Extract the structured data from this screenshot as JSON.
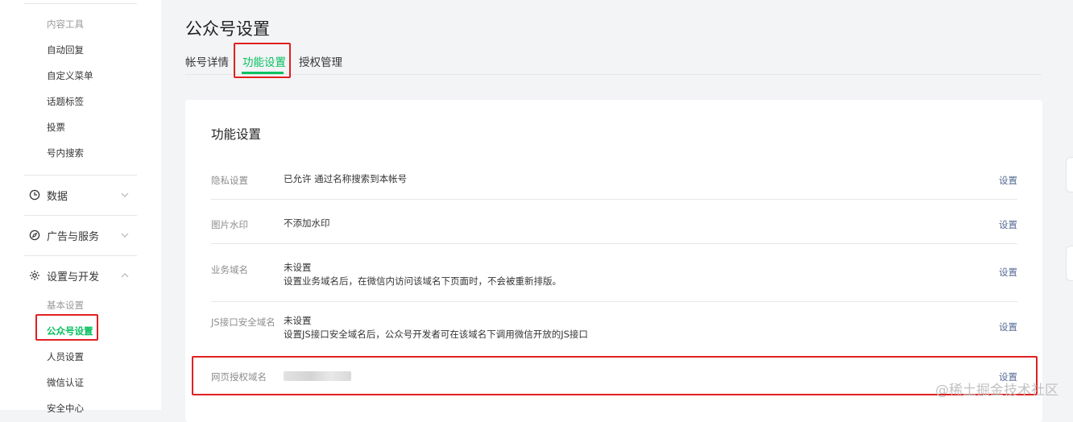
{
  "sidebar": {
    "content_tools_label": "内容工具",
    "content_items": [
      "自动回复",
      "自定义菜单",
      "话题标签",
      "投票",
      "号内搜索"
    ],
    "groups": {
      "data": "数据",
      "ads": "广告与服务",
      "settings": "设置与开发"
    },
    "basic_settings_label": "基本设置",
    "settings_items": [
      "公众号设置",
      "人员设置",
      "微信认证",
      "安全中心"
    ],
    "active_item": "公众号设置"
  },
  "main": {
    "page_title": "公众号设置",
    "tabs": [
      "帐号详情",
      "功能设置",
      "授权管理"
    ],
    "active_tab": "功能设置",
    "card_title": "功能设置",
    "rows": [
      {
        "label": "隐私设置",
        "line1": "已允许 通过名称搜索到本帐号",
        "line2": "",
        "action": "设置"
      },
      {
        "label": "图片水印",
        "line1": "不添加水印",
        "line2": "",
        "action": "设置"
      },
      {
        "label": "业务域名",
        "line1": "未设置",
        "line2": "设置业务域名后，在微信内访问该域名下页面时，不会被重新排版。",
        "action": "设置"
      },
      {
        "label": "JS接口安全域名",
        "line1": "未设置",
        "line2": "设置JS接口安全域名后，公众号开发者可在该域名下调用微信开放的JS接口",
        "action": "设置"
      },
      {
        "label": "网页授权域名",
        "line1": "",
        "line2": "",
        "action": "设置"
      }
    ]
  },
  "watermark": "@稀土掘金技术社区",
  "colors": {
    "accent": "#07c160",
    "highlight": "#e02020",
    "link": "#576b95"
  }
}
